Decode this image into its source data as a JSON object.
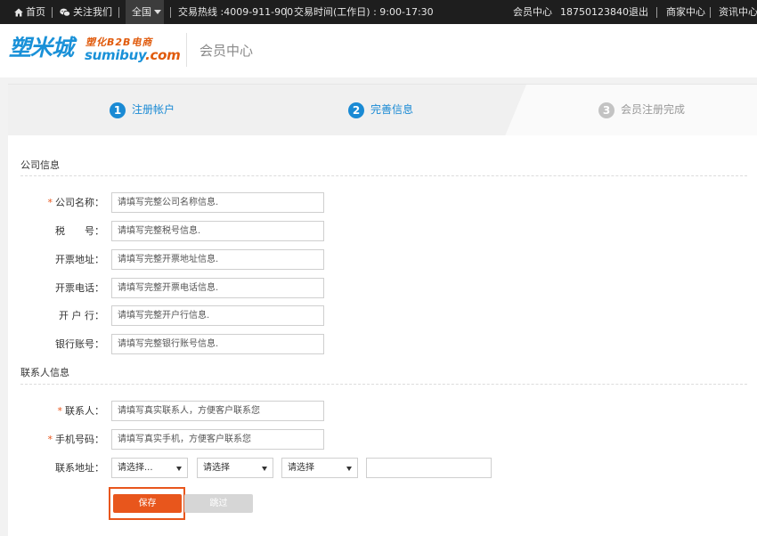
{
  "topbar": {
    "home": "首页",
    "follow": "关注我们",
    "region": "全国",
    "hotline": "交易热线 :4009-911-900",
    "hours": "交易时间(工作日) : 9:00-17:30",
    "member_center": "会员中心",
    "phone": "18750123840",
    "logout": "退出",
    "merchant_center": "商家中心",
    "news_center": "资讯中心"
  },
  "header": {
    "logo_cn": "塑米城",
    "logo_tagline": "塑化B2B电商",
    "logo_en_main": "sumibuy",
    "logo_en_suffix": ".com",
    "title": "会员中心"
  },
  "steps": [
    {
      "num": "1",
      "label": "注册帐户",
      "state": "active"
    },
    {
      "num": "2",
      "label": "完善信息",
      "state": "active"
    },
    {
      "num": "3",
      "label": "会员注册完成",
      "state": "inactive"
    }
  ],
  "company_section": {
    "title": "公司信息",
    "fields": [
      {
        "label": "公司名称：",
        "required": "*",
        "placeholder": "请填写完整公司名称信息."
      },
      {
        "label": "税　　号：",
        "placeholder": "请填写完整税号信息."
      },
      {
        "label": "开票地址：",
        "placeholder": "请填写完整开票地址信息."
      },
      {
        "label": "开票电话：",
        "placeholder": "请填写完整开票电话信息."
      },
      {
        "label": "开 户 行：",
        "placeholder": "请填写完整开户行信息."
      },
      {
        "label": "银行账号：",
        "placeholder": "请填写完整银行账号信息."
      }
    ]
  },
  "contact_section": {
    "title": "联系人信息",
    "fields": [
      {
        "label": "联系人：",
        "required": "*",
        "placeholder": "请填写真实联系人，方便客户联系您"
      },
      {
        "label": "手机号码：",
        "required": "*",
        "placeholder": "请填写真实手机，方便客户联系您"
      }
    ],
    "address_label": "联系地址：",
    "selects": [
      "请选择...",
      "请选择",
      "请选择"
    ],
    "address_value": ""
  },
  "buttons": {
    "save": "保存",
    "skip": "跳过"
  },
  "colors": {
    "accent_blue": "#1a8ad4",
    "accent_orange": "#e8561c",
    "topbar_bg": "#1e1e1e"
  }
}
